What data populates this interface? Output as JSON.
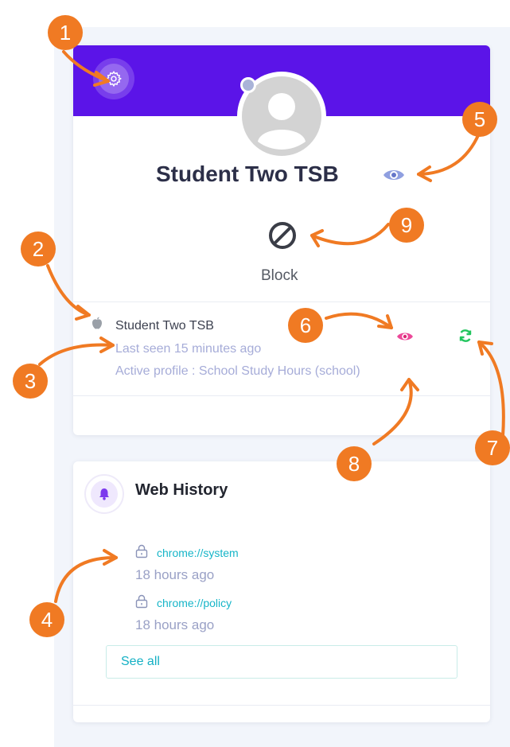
{
  "profile": {
    "name": "Student Two TSB",
    "block_label": "Block"
  },
  "device": {
    "name": "Student Two TSB",
    "last_seen": "Last seen 15 minutes ago",
    "active_profile": "Active profile : School Study Hours (school)"
  },
  "web_history": {
    "title": "Web History",
    "items": [
      {
        "url": "chrome://system",
        "time": "18 hours ago"
      },
      {
        "url": "chrome://policy",
        "time": "18 hours ago"
      }
    ],
    "see_all_label": "See all"
  },
  "callouts": [
    "1",
    "2",
    "3",
    "4",
    "5",
    "6",
    "7",
    "8",
    "9"
  ],
  "colors": {
    "banner": "#5b14e8",
    "callout": "#f07a23",
    "link": "#16b5c8",
    "refresh": "#22c55e",
    "eye_pink": "#ec4899"
  }
}
